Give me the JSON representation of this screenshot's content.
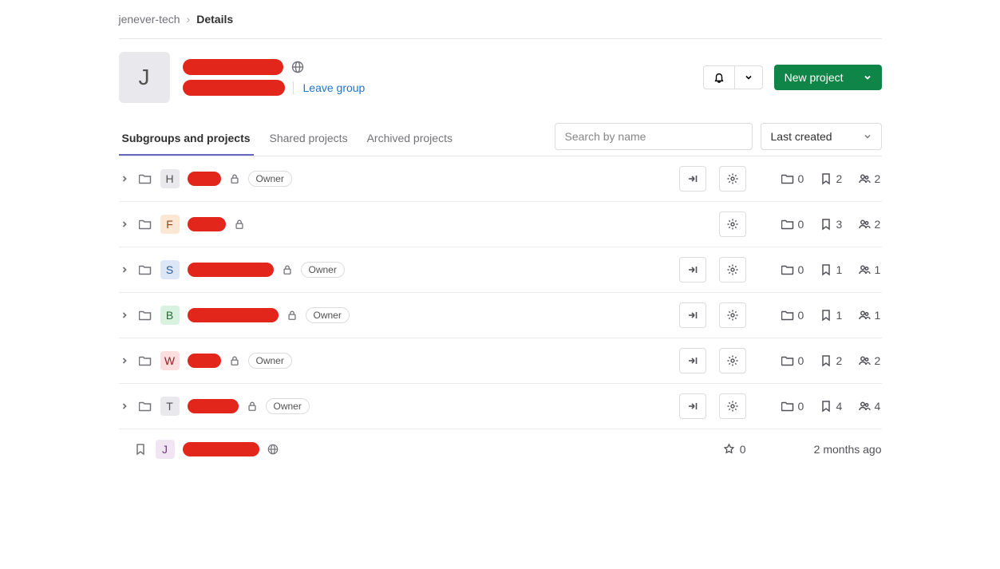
{
  "breadcrumb": {
    "parent": "jenever-tech",
    "current": "Details"
  },
  "group": {
    "avatar_letter": "J",
    "leave_label": "Leave group"
  },
  "actions": {
    "new_project_label": "New project"
  },
  "tabs": {
    "subgroups": "Subgroups and projects",
    "shared": "Shared projects",
    "archived": "Archived projects"
  },
  "search": {
    "placeholder": "Search by name"
  },
  "sort": {
    "selected": "Last created"
  },
  "items": [
    {
      "type": "group",
      "letter": "H",
      "avatar_bg": "#e9e8ed",
      "avatar_fg": "#525252",
      "name_width": 42,
      "lock": true,
      "badge": "Owner",
      "fork_btn": true,
      "settings_btn": true,
      "subgroups": 0,
      "projects": 2,
      "members": 2
    },
    {
      "type": "group",
      "letter": "F",
      "avatar_bg": "#fce6d4",
      "avatar_fg": "#8b4a13",
      "name_width": 48,
      "lock": true,
      "badge": null,
      "fork_btn": false,
      "settings_btn": true,
      "subgroups": 0,
      "projects": 3,
      "members": 2
    },
    {
      "type": "group",
      "letter": "S",
      "avatar_bg": "#dbe7f6",
      "avatar_fg": "#2a5a95",
      "name_width": 108,
      "lock": true,
      "badge": "Owner",
      "fork_btn": true,
      "settings_btn": true,
      "subgroups": 0,
      "projects": 1,
      "members": 1
    },
    {
      "type": "group",
      "letter": "B",
      "avatar_bg": "#d8f2df",
      "avatar_fg": "#246b36",
      "name_width": 114,
      "lock": true,
      "badge": "Owner",
      "fork_btn": true,
      "settings_btn": true,
      "subgroups": 0,
      "projects": 1,
      "members": 1
    },
    {
      "type": "group",
      "letter": "W",
      "avatar_bg": "#fddede",
      "avatar_fg": "#8a2626",
      "name_width": 42,
      "lock": true,
      "badge": "Owner",
      "fork_btn": true,
      "settings_btn": true,
      "subgroups": 0,
      "projects": 2,
      "members": 2
    },
    {
      "type": "group",
      "letter": "T",
      "avatar_bg": "#e9e8ed",
      "avatar_fg": "#525252",
      "name_width": 64,
      "lock": true,
      "badge": "Owner",
      "fork_btn": true,
      "settings_btn": true,
      "subgroups": 0,
      "projects": 4,
      "members": 4
    },
    {
      "type": "project",
      "letter": "J",
      "avatar_bg": "#f1e4f3",
      "avatar_fg": "#6a3d73",
      "name_width": 96,
      "globe": true,
      "stars": 0,
      "time_ago": "2 months ago"
    }
  ]
}
